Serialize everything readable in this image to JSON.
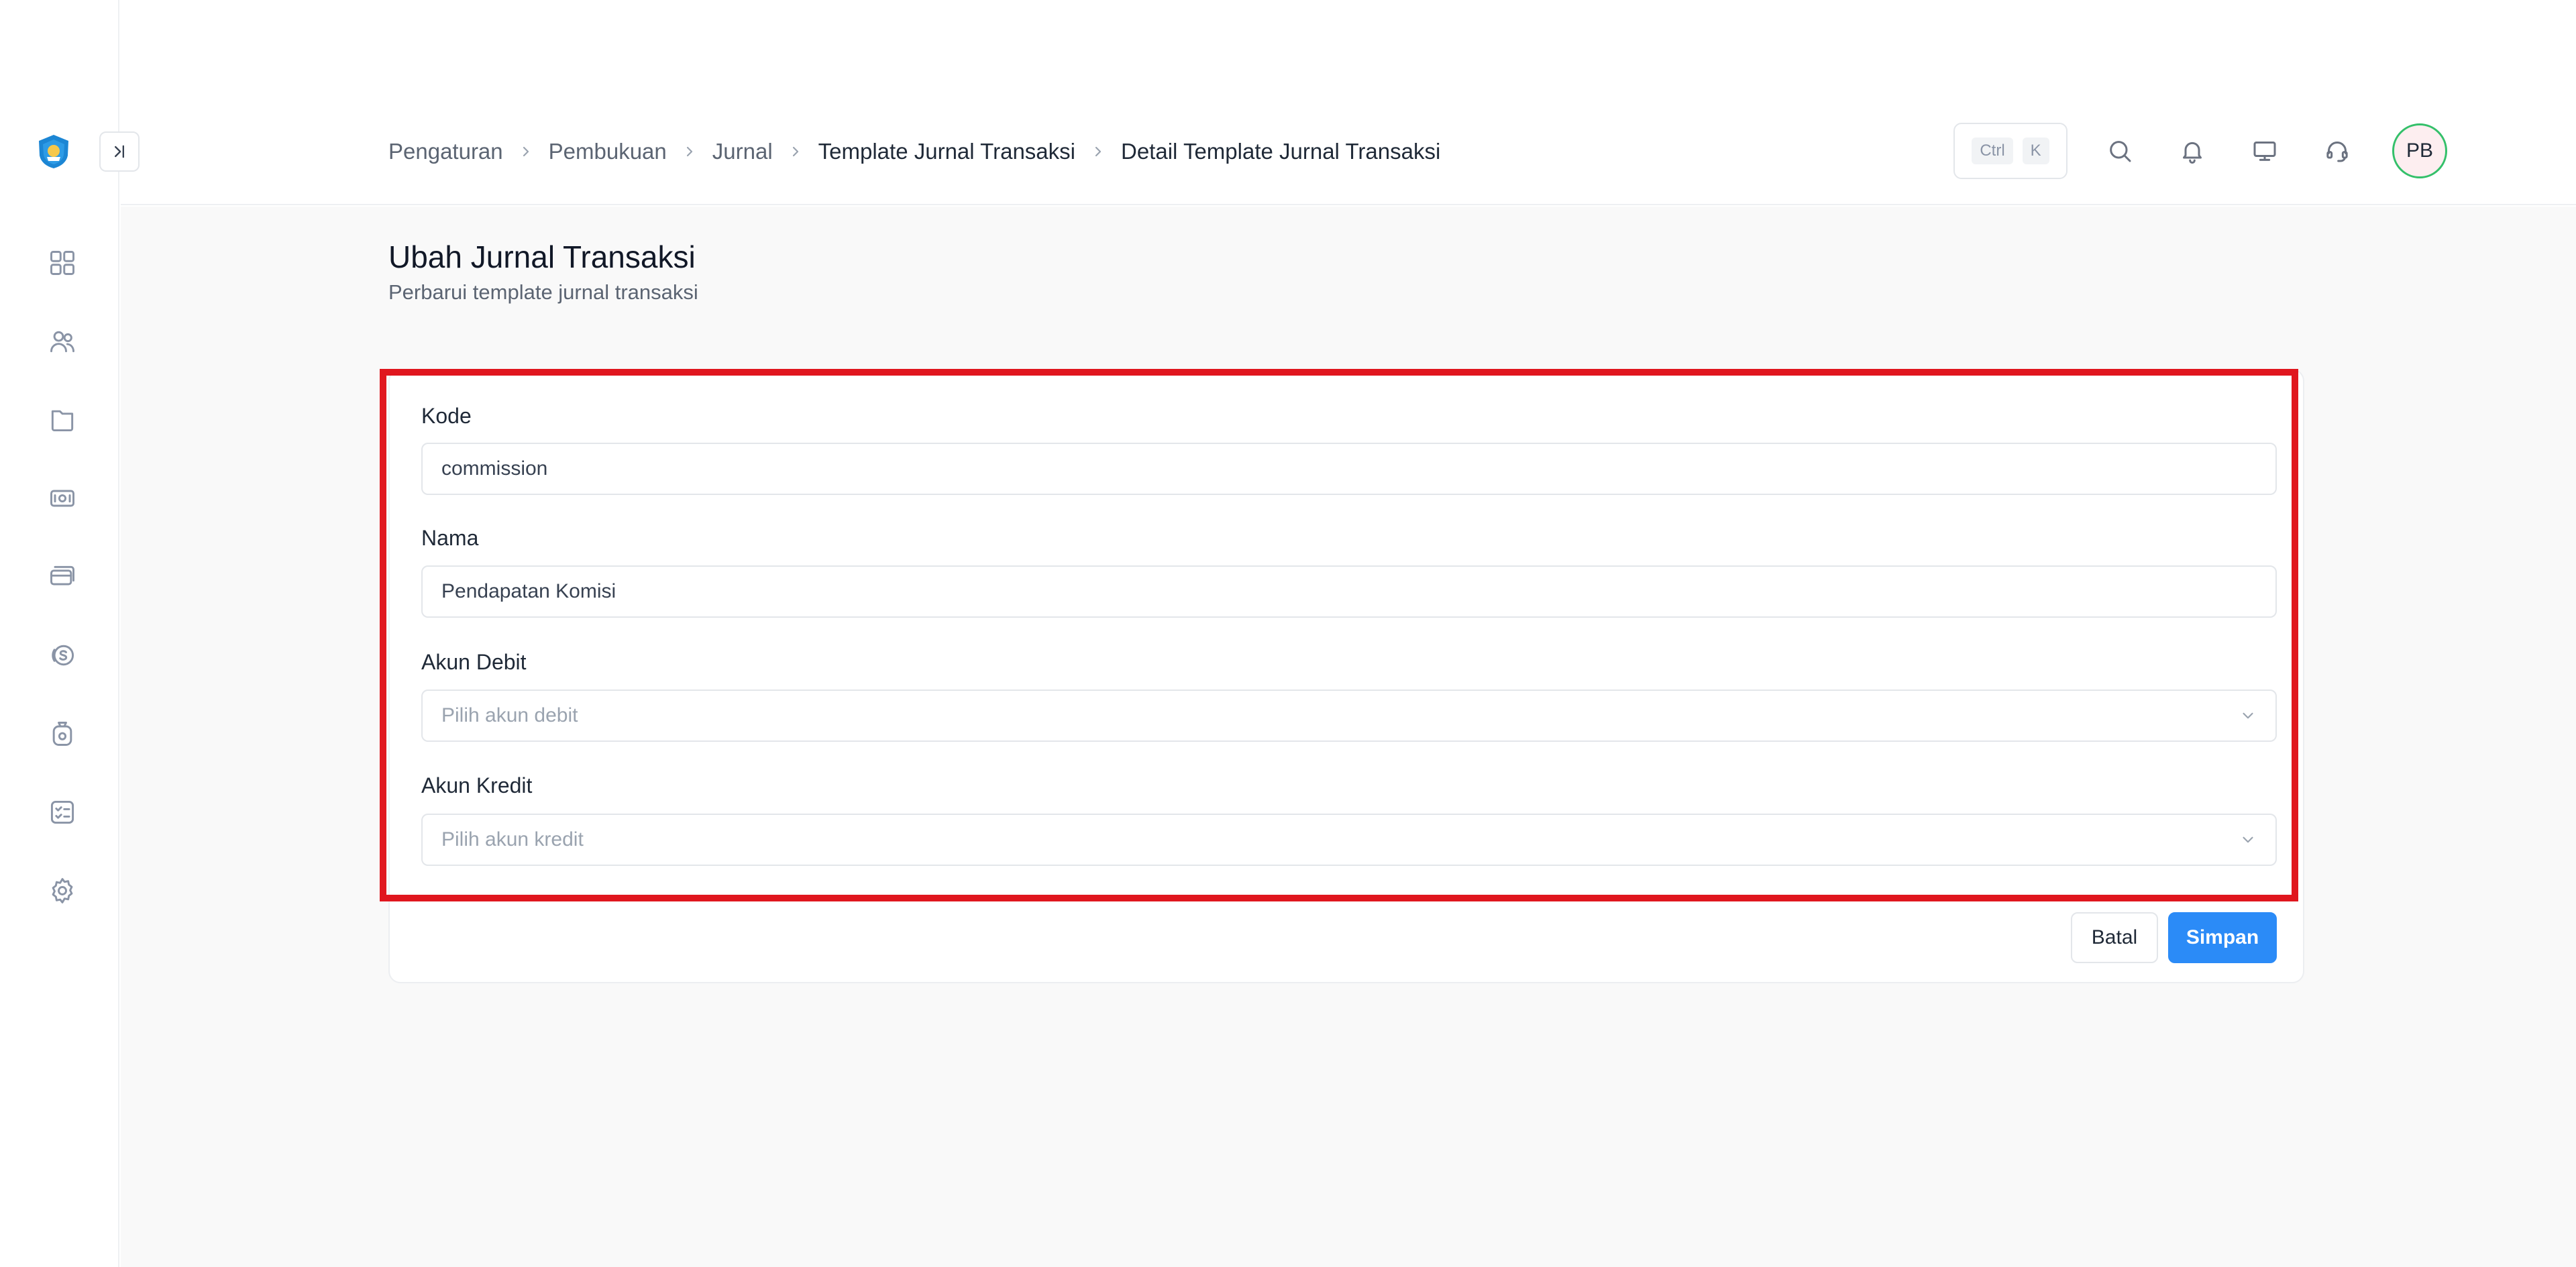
{
  "header": {
    "breadcrumb": [
      "Pengaturan",
      "Pembukuan",
      "Jurnal",
      "Template Jurnal Transaksi",
      "Detail Template Jurnal Transaksi"
    ],
    "shortcut": {
      "key1": "Ctrl",
      "key2": "K"
    },
    "avatar_initials": "PB",
    "icons": [
      "search-icon",
      "bell-icon",
      "monitor-icon",
      "headset-icon"
    ]
  },
  "sidebar": {
    "icons": [
      "dashboard-icon",
      "users-icon",
      "folder-icon",
      "cash-icon",
      "card-icon",
      "coin-icon",
      "bag-icon",
      "checklist-icon",
      "settings-icon"
    ]
  },
  "page": {
    "title": "Ubah Jurnal Transaksi",
    "subtitle": "Perbarui template jurnal transaksi"
  },
  "form": {
    "kode_label": "Kode",
    "kode_value": "commission",
    "nama_label": "Nama",
    "nama_value": "Pendapatan Komisi",
    "debit_label": "Akun Debit",
    "debit_placeholder": "Pilih akun debit",
    "kredit_label": "Akun Kredit",
    "kredit_placeholder": "Pilih akun kredit",
    "cancel_label": "Batal",
    "save_label": "Simpan"
  },
  "colors": {
    "accent": "#2b8bf7",
    "highlight": "#e0161e",
    "avatar_ring": "#34c06a"
  }
}
